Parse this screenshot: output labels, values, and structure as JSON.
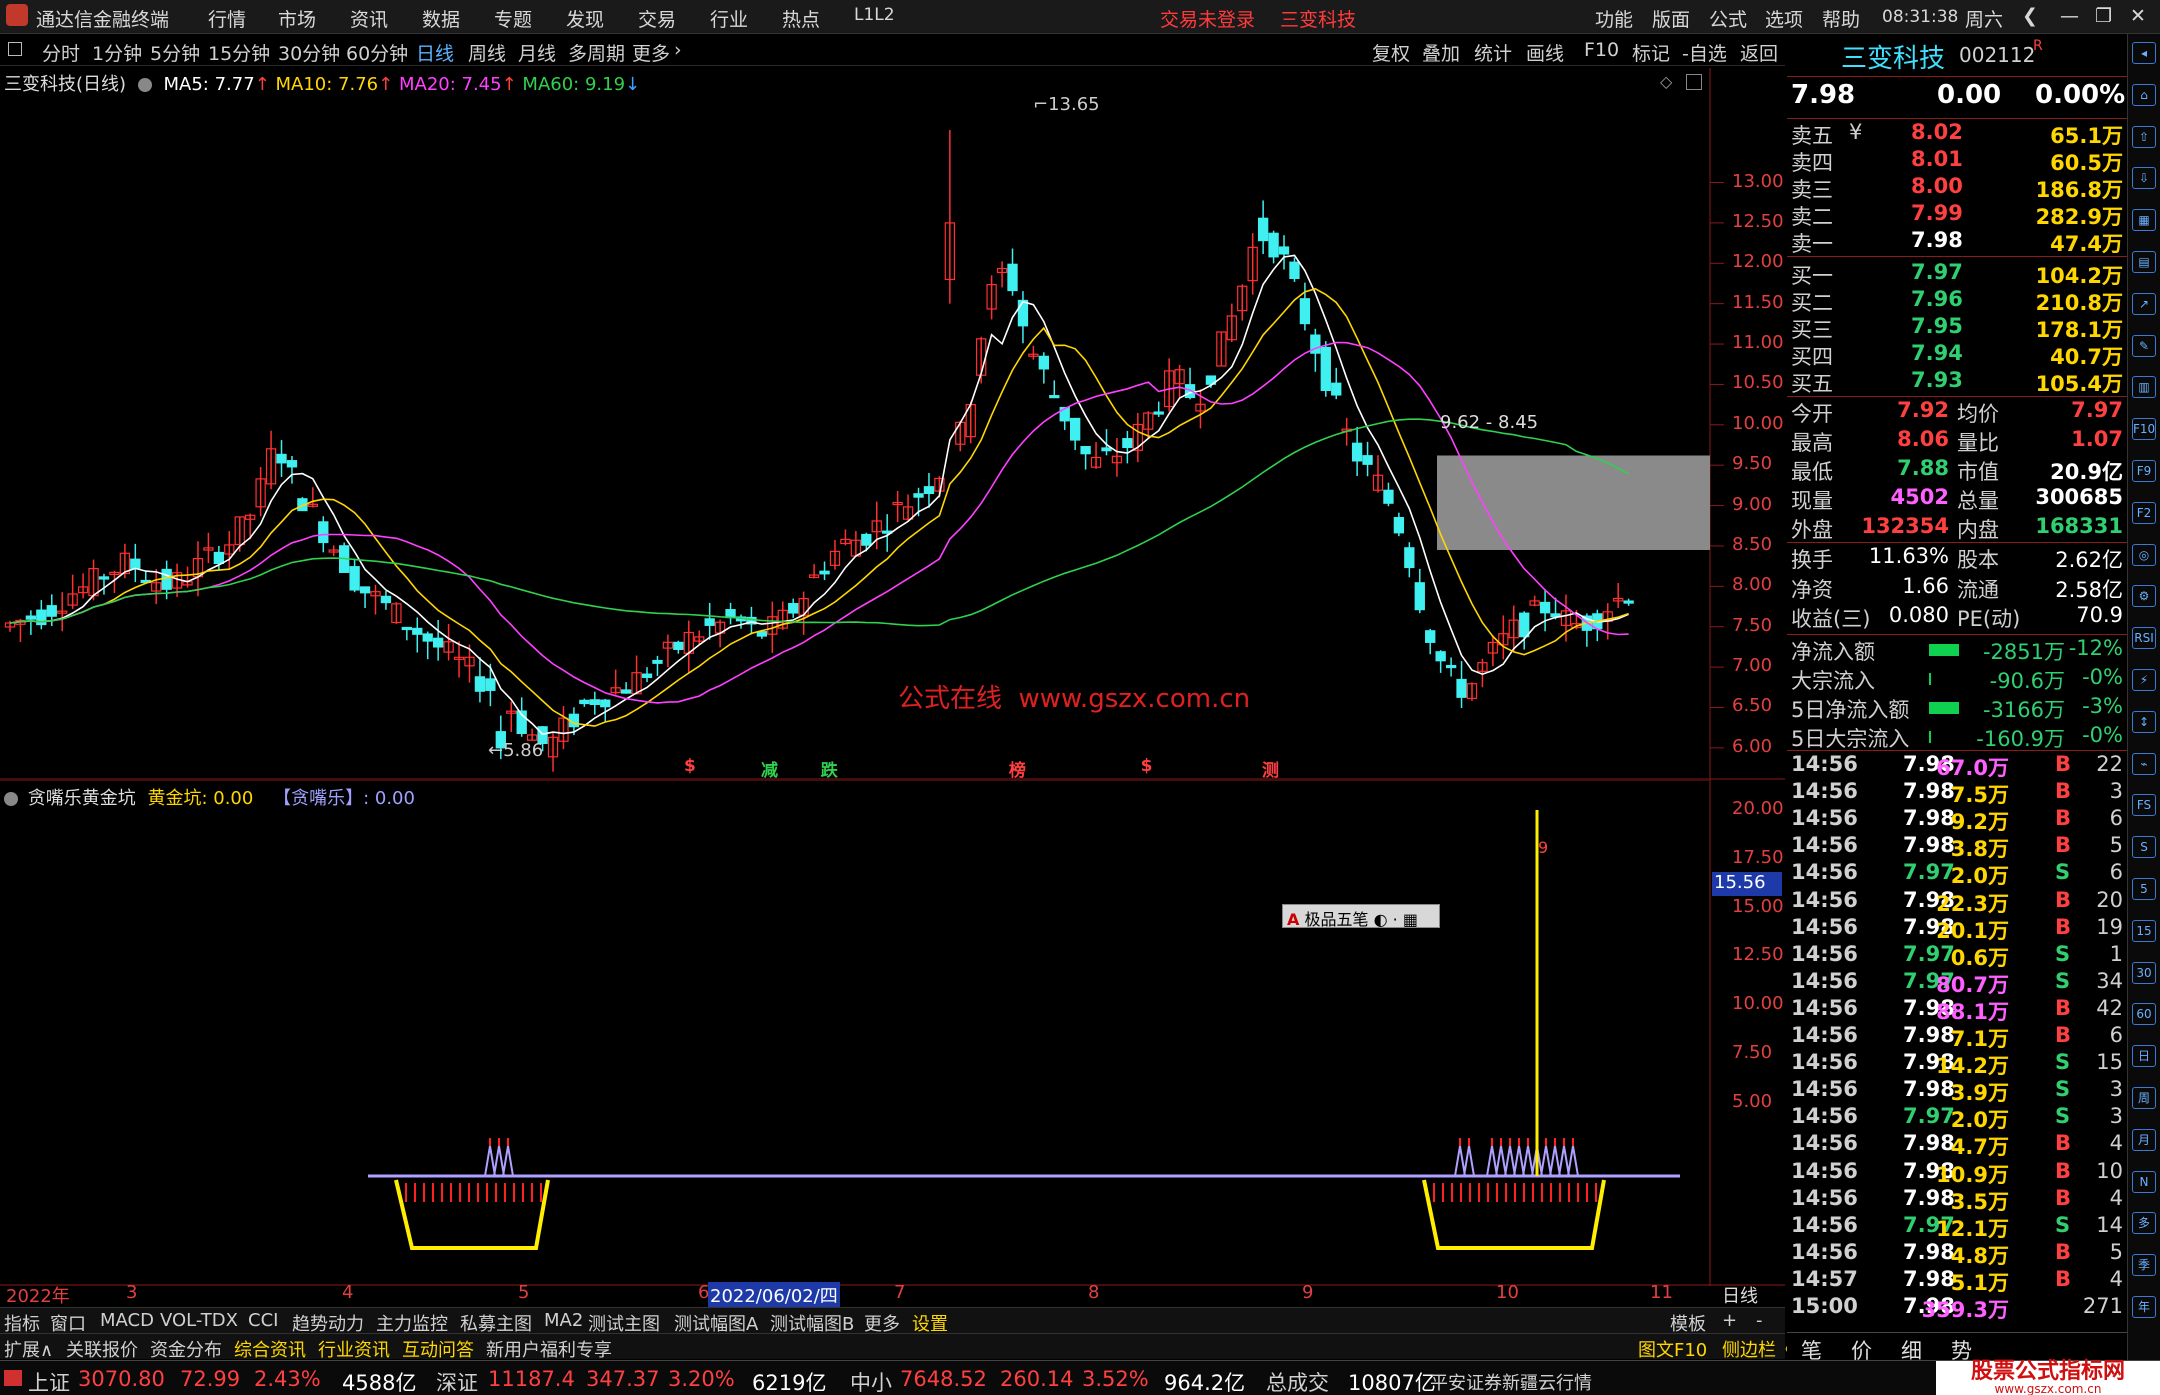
{
  "titlebar": {
    "app_name": "通达信金融终端",
    "menus": [
      "行情",
      "市场",
      "资讯",
      "数据",
      "专题",
      "发现",
      "交易",
      "行业",
      "热点",
      "L1L2"
    ],
    "trade_status": "交易未登录",
    "stock_name": "三变科技",
    "right_menus": [
      "功能",
      "版面",
      "公式",
      "选项",
      "帮助"
    ],
    "clock": "08:31:38",
    "weekday": "周六"
  },
  "toolbar": {
    "periods": [
      "分时",
      "1分钟",
      "5分钟",
      "15分钟",
      "30分钟",
      "60分钟",
      "日线",
      "周线",
      "月线",
      "多周期",
      "更多"
    ],
    "selected_period": "日线",
    "actions": [
      "复权",
      "叠加",
      "统计",
      "画线",
      "F10",
      "标记",
      "-自选",
      "返回"
    ]
  },
  "main_chart": {
    "header_title": "三变科技(日线)",
    "ma": [
      {
        "label": "MA5: 7.77",
        "color": "#ffffff"
      },
      {
        "label": "MA10: 7.76",
        "color": "#ffd700"
      },
      {
        "label": "MA20: 7.45",
        "color": "#ff40ff"
      },
      {
        "label": "MA60: 9.19",
        "color": "#30d050"
      }
    ],
    "y_ticks": [
      "13.00",
      "12.50",
      "12.00",
      "11.50",
      "11.00",
      "10.50",
      "10.00",
      "9.50",
      "9.00",
      "8.50",
      "8.00",
      "7.50",
      "7.00",
      "6.50",
      "6.00"
    ],
    "high_label": "13.65",
    "low_label": "5.86",
    "gap_label": "9.62 - 8.45",
    "watermark": "公式在线  www.gszx.com.cn",
    "event_markers": [
      {
        "text": "$",
        "x": 0.4
      },
      {
        "text": "减",
        "x": 0.445
      },
      {
        "text": "跌",
        "x": 0.48
      },
      {
        "text": "榜",
        "x": 0.59
      },
      {
        "text": "$",
        "x": 0.667
      },
      {
        "text": "测",
        "x": 0.738
      }
    ]
  },
  "sub_chart": {
    "indicator_name": "贪嘴乐黄金坑",
    "line1": "黄金坑: 0.00",
    "line2": "【贪嘴乐】: 0.00",
    "y_ticks": [
      "20.00",
      "17.50",
      "15.00",
      "12.50",
      "10.00",
      "7.50",
      "5.00"
    ],
    "cursor_value": "15.56",
    "popup_label": "极品五笔",
    "spike_label": "9",
    "x_axis": [
      "2022年",
      "3",
      "4",
      "5",
      "6",
      "7",
      "8",
      "9",
      "10",
      "11"
    ],
    "x_axis_highlight": "2022/06/02/四",
    "period_label": "日线"
  },
  "chart_data": [
    {
      "type": "candlestick",
      "title": "三变科技(日线)",
      "ylim": [
        5.8,
        13.7
      ],
      "y_max_label": 13.65,
      "y_min_label": 5.86,
      "ma": {
        "MA5": 7.77,
        "MA10": 7.76,
        "MA20": 7.45,
        "MA60": 9.19
      },
      "gap_zone": [
        8.45,
        9.62
      ],
      "close_series": [
        7.5,
        7.6,
        7.7,
        7.9,
        8.0,
        8.2,
        8.3,
        8.1,
        8.0,
        8.2,
        8.4,
        8.6,
        9.0,
        9.8,
        9.2,
        8.8,
        8.4,
        8.0,
        7.8,
        7.6,
        7.4,
        7.2,
        7.0,
        6.8,
        6.6,
        6.2,
        6.0,
        6.3,
        6.6,
        6.7,
        6.8,
        7.0,
        7.2,
        7.4,
        7.5,
        7.6,
        7.4,
        7.5,
        7.8,
        8.2,
        8.5,
        8.6,
        8.8,
        9.0,
        9.2,
        9.5,
        10.0,
        11.5,
        12.0,
        11.0,
        10.5,
        10.0,
        9.5,
        9.6,
        9.8,
        10.2,
        10.6,
        10.3,
        10.8,
        11.5,
        12.4,
        12.2,
        11.5,
        10.8,
        10.0,
        9.5,
        9.2,
        8.6,
        7.6,
        6.9,
        6.7,
        7.1,
        7.4,
        7.6,
        7.8,
        7.5,
        7.6,
        7.8,
        7.98
      ]
    },
    {
      "type": "bar",
      "title": "贪嘴乐黄金坑",
      "ylim": [
        0,
        20
      ],
      "series": [
        {
          "name": "黄金坑",
          "last": 0.0
        },
        {
          "name": "【贪嘴乐】",
          "last": 0.0,
          "spike_value": 20
        }
      ]
    }
  ],
  "bottom_tabs1": [
    "指标",
    "窗口",
    "MACD",
    "VOL-TDX",
    "CCI",
    "趋势动力",
    "主力监控",
    "私募主图",
    "MA2",
    "测试主图",
    "测试幅图A",
    "测试幅图B",
    "更多",
    "设置"
  ],
  "bottom_tabs1_right": [
    "模板",
    "+",
    "-"
  ],
  "bottom_tabs2": [
    "扩展∧",
    "关联报价",
    "资金分布",
    "综合资讯",
    "行业资讯",
    "互动问答",
    "新用户福利专享"
  ],
  "bottom_tabs2_right": [
    "图文F10",
    "侧边栏《",
    "笔",
    "价",
    "细",
    "势"
  ],
  "quote": {
    "name": "三变科技",
    "code": "002112",
    "flag": "R",
    "price": "7.98",
    "change": "0.00",
    "pct": "0.00%",
    "asks": [
      {
        "label": "卖五",
        "sym": "¥",
        "price": "8.02",
        "vol": "65.1万"
      },
      {
        "label": "卖四",
        "sym": "",
        "price": "8.01",
        "vol": "60.5万"
      },
      {
        "label": "卖三",
        "sym": "",
        "price": "8.00",
        "vol": "186.8万"
      },
      {
        "label": "卖二",
        "sym": "",
        "price": "7.99",
        "vol": "282.9万"
      },
      {
        "label": "卖一",
        "sym": "",
        "price": "7.98",
        "vol": "47.4万"
      }
    ],
    "bids": [
      {
        "label": "买一",
        "price": "7.97",
        "vol": "104.2万"
      },
      {
        "label": "买二",
        "price": "7.96",
        "vol": "210.8万"
      },
      {
        "label": "买三",
        "price": "7.95",
        "vol": "178.1万"
      },
      {
        "label": "买四",
        "price": "7.94",
        "vol": "40.7万"
      },
      {
        "label": "买五",
        "price": "7.93",
        "vol": "105.4万"
      }
    ],
    "stats": [
      {
        "l1": "今开",
        "v1": "7.92",
        "c1": "red",
        "l2": "均价",
        "v2": "7.97",
        "c2": "red"
      },
      {
        "l1": "最高",
        "v1": "8.06",
        "c1": "red",
        "l2": "量比",
        "v2": "1.07",
        "c2": "red"
      },
      {
        "l1": "最低",
        "v1": "7.88",
        "c1": "grn",
        "l2": "市值",
        "v2": "20.9亿",
        "c2": "wht"
      },
      {
        "l1": "现量",
        "v1": "4502",
        "c1": "mag",
        "l2": "总量",
        "v2": "300685",
        "c2": "wht"
      },
      {
        "l1": "外盘",
        "v1": "132354",
        "c1": "red",
        "l2": "内盘",
        "v2": "168331",
        "c2": "grn"
      }
    ],
    "stats2": [
      {
        "l1": "换手",
        "v1": "11.63%",
        "l2": "股本",
        "v2": "2.62亿"
      },
      {
        "l1": "净资",
        "v1": "1.66",
        "l2": "流通",
        "v2": "2.58亿"
      },
      {
        "l1": "收益(三)",
        "v1": "0.080",
        "l2": "PE(动)",
        "v2": "70.9"
      }
    ],
    "flows": [
      {
        "label": "净流入额",
        "bar": 1.0,
        "value": "-2851万",
        "pct": "-12%"
      },
      {
        "label": "大宗流入",
        "bar": 0.05,
        "value": "-90.6万",
        "pct": "-0%"
      },
      {
        "label": "5日净流入额",
        "bar": 1.0,
        "value": "-3166万",
        "pct": "-3%"
      },
      {
        "label": "5日大宗流入",
        "bar": 0.05,
        "value": "-160.9万",
        "pct": "-0%"
      }
    ],
    "ticks": [
      {
        "t": "14:56",
        "p": "7.98",
        "pc": "wht",
        "v": "67.0万",
        "vc": "mag",
        "d": "B",
        "n": "22"
      },
      {
        "t": "14:56",
        "p": "7.98",
        "pc": "wht",
        "v": "7.5万",
        "vc": "yel",
        "d": "B",
        "n": "3"
      },
      {
        "t": "14:56",
        "p": "7.98",
        "pc": "wht",
        "v": "9.2万",
        "vc": "yel",
        "d": "B",
        "n": "6"
      },
      {
        "t": "14:56",
        "p": "7.98",
        "pc": "wht",
        "v": "3.8万",
        "vc": "yel",
        "d": "B",
        "n": "5"
      },
      {
        "t": "14:56",
        "p": "7.97",
        "pc": "grn",
        "v": "2.0万",
        "vc": "yel",
        "d": "S",
        "n": "6"
      },
      {
        "t": "14:56",
        "p": "7.98",
        "pc": "wht",
        "v": "22.3万",
        "vc": "yel",
        "d": "B",
        "n": "20"
      },
      {
        "t": "14:56",
        "p": "7.98",
        "pc": "wht",
        "v": "20.1万",
        "vc": "yel",
        "d": "B",
        "n": "19"
      },
      {
        "t": "14:56",
        "p": "7.97",
        "pc": "grn",
        "v": "0.6万",
        "vc": "yel",
        "d": "S",
        "n": "1"
      },
      {
        "t": "14:56",
        "p": "7.97",
        "pc": "grn",
        "v": "80.7万",
        "vc": "mag",
        "d": "S",
        "n": "34"
      },
      {
        "t": "14:56",
        "p": "7.98",
        "pc": "wht",
        "v": "88.1万",
        "vc": "mag",
        "d": "B",
        "n": "42"
      },
      {
        "t": "14:56",
        "p": "7.98",
        "pc": "wht",
        "v": "7.1万",
        "vc": "yel",
        "d": "B",
        "n": "6"
      },
      {
        "t": "14:56",
        "p": "7.98",
        "pc": "wht",
        "v": "14.2万",
        "vc": "yel",
        "d": "S",
        "n": "15"
      },
      {
        "t": "14:56",
        "p": "7.98",
        "pc": "wht",
        "v": "3.9万",
        "vc": "yel",
        "d": "S",
        "n": "3"
      },
      {
        "t": "14:56",
        "p": "7.97",
        "pc": "grn",
        "v": "2.0万",
        "vc": "yel",
        "d": "S",
        "n": "3"
      },
      {
        "t": "14:56",
        "p": "7.98",
        "pc": "wht",
        "v": "4.7万",
        "vc": "yel",
        "d": "B",
        "n": "4"
      },
      {
        "t": "14:56",
        "p": "7.98",
        "pc": "wht",
        "v": "10.9万",
        "vc": "yel",
        "d": "B",
        "n": "10"
      },
      {
        "t": "14:56",
        "p": "7.98",
        "pc": "wht",
        "v": "3.5万",
        "vc": "yel",
        "d": "B",
        "n": "4"
      },
      {
        "t": "14:56",
        "p": "7.97",
        "pc": "grn",
        "v": "12.1万",
        "vc": "yel",
        "d": "S",
        "n": "14"
      },
      {
        "t": "14:56",
        "p": "7.98",
        "pc": "wht",
        "v": "4.8万",
        "vc": "yel",
        "d": "B",
        "n": "5"
      },
      {
        "t": "14:57",
        "p": "7.98",
        "pc": "wht",
        "v": "5.1万",
        "vc": "yel",
        "d": "B",
        "n": "4"
      },
      {
        "t": "15:00",
        "p": "7.98",
        "pc": "wht",
        "v": "359.3万",
        "vc": "mag",
        "d": "",
        "n": "271"
      }
    ]
  },
  "side_icons": [
    "◂",
    "⌂",
    "⇧",
    "⇩",
    "▦",
    "▤",
    "↗",
    "✎",
    "▥",
    "F10",
    "F9",
    "F2",
    "◎",
    "⚙",
    "RSI",
    "⚡",
    "↕",
    "⌁",
    "FS",
    "S",
    "5",
    "15",
    "30",
    "60",
    "日",
    "周",
    "月",
    "N",
    "多",
    "季",
    "年"
  ],
  "statusbar": {
    "items": [
      {
        "name": "上证",
        "value": "3070.80",
        "chg": "72.99",
        "pct": "2.43%",
        "amt": "4588亿"
      },
      {
        "name": "深证",
        "value": "11187.4",
        "chg": "347.37",
        "pct": "3.20%",
        "amt": "6219亿"
      },
      {
        "name": "中小",
        "value": "7648.52",
        "chg": "260.14",
        "pct": "3.52%",
        "amt": "964.2亿"
      }
    ],
    "total_label": "总成交",
    "total_value": "10807亿",
    "broker": "平安证券新疆云行情",
    "logo_text": "股票公式指标网",
    "logo_url": "www.gszx.com.cn"
  }
}
